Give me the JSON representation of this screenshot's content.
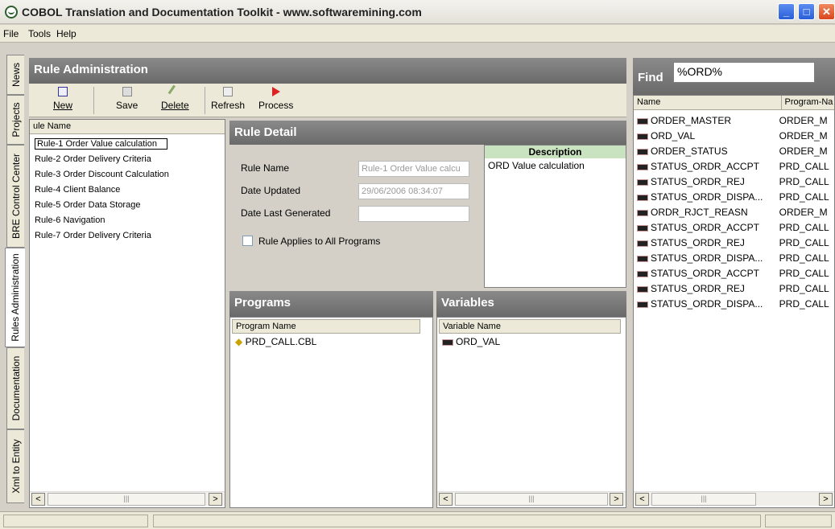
{
  "window": {
    "title": "COBOL Translation and Documentation Toolkit - www.softwaremining.com"
  },
  "menu": {
    "items": [
      "File",
      "Tools",
      "Help"
    ]
  },
  "vtabs": [
    "News",
    "Projects",
    "BRE Control Center",
    "Rules Administration",
    "Documentation",
    "Xml to Entity"
  ],
  "rule_admin": {
    "title": "Rule Administration",
    "toolbar": {
      "new": "New",
      "save": "Save",
      "delete": "Delete",
      "refresh": "Refresh",
      "process": "Process"
    },
    "list_header": "ule Name",
    "rules": [
      "Rule-1 Order Value calculation",
      "Rule-2 Order Delivery Criteria",
      "Rule-3 Order Discount Calculation",
      "Rule-4 Client Balance",
      "Rule-5 Order Data Storage",
      "Rule-6 Navigation",
      "Rule-7 Order Delivery Criteria"
    ]
  },
  "rule_detail": {
    "title": "Rule Detail",
    "rule_name_label": "Rule Name",
    "rule_name_value": "Rule-1 Order Value calcu",
    "date_updated_label": "Date Updated",
    "date_updated_value": "29/06/2006 08:34:07",
    "date_generated_label": "Date Last Generated",
    "date_generated_value": "",
    "applies_label": "Rule Applies to All Programs",
    "description_header": "Description",
    "description_value": "ORD Value calculation"
  },
  "programs": {
    "title": "Programs",
    "column": "Program Name",
    "items": [
      "PRD_CALL.CBL"
    ]
  },
  "variables": {
    "title": "Variables",
    "column": "Variable Name",
    "items": [
      "ORD_VAL"
    ]
  },
  "find": {
    "label": "Find",
    "query": "%ORD%",
    "col_name": "Name",
    "col_program": "Program-Na",
    "rows": [
      {
        "name": "ORDER_MASTER",
        "program": "ORDER_M"
      },
      {
        "name": "ORD_VAL",
        "program": "ORDER_M"
      },
      {
        "name": "ORDER_STATUS",
        "program": "ORDER_M"
      },
      {
        "name": "STATUS_ORDR_ACCPT",
        "program": "PRD_CALL"
      },
      {
        "name": "STATUS_ORDR_REJ",
        "program": "PRD_CALL"
      },
      {
        "name": "STATUS_ORDR_DISPA...",
        "program": "PRD_CALL"
      },
      {
        "name": "ORDR_RJCT_REASN",
        "program": "ORDER_M"
      },
      {
        "name": "STATUS_ORDR_ACCPT",
        "program": "PRD_CALL"
      },
      {
        "name": "STATUS_ORDR_REJ",
        "program": "PRD_CALL"
      },
      {
        "name": "STATUS_ORDR_DISPA...",
        "program": "PRD_CALL"
      },
      {
        "name": "STATUS_ORDR_ACCPT",
        "program": "PRD_CALL"
      },
      {
        "name": "STATUS_ORDR_REJ",
        "program": "PRD_CALL"
      },
      {
        "name": "STATUS_ORDR_DISPA...",
        "program": "PRD_CALL"
      }
    ]
  }
}
